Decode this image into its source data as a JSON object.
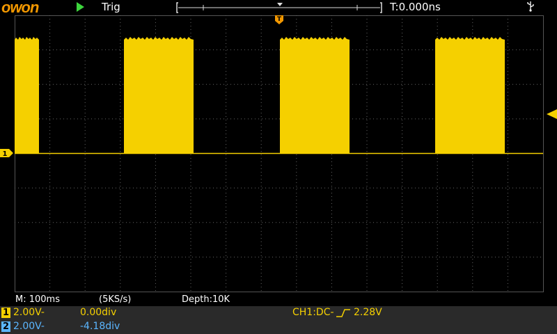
{
  "header": {
    "logo": "owon",
    "run_state": "run-triangle",
    "trigger_status": "Trig",
    "time_offset": "T:0.000ns",
    "usb_icon": "usb-icon"
  },
  "markers": {
    "trigger_position": "T",
    "ch1_ground": "1",
    "trigger_level": "trigger-level-arrow"
  },
  "status": {
    "timebase": "M: 100ms",
    "sample_rate": "(5KS/s)",
    "depth": "Depth:10K"
  },
  "channels": [
    {
      "tag": "1",
      "volts": "2.00V-",
      "position": "0.00div",
      "color": "#f5d000",
      "text_color": "#f5d000"
    },
    {
      "tag": "2",
      "volts": "2.00V-",
      "position": "-4.18div",
      "color": "#5bb6ff",
      "text_color": "#5bb6ff"
    }
  ],
  "trigger": {
    "source_label": "CH1:DC-",
    "level": "2.28V"
  },
  "colors": {
    "ch1": "#f5d000",
    "ch2": "#5bb6ff",
    "brand": "#f39800",
    "run": "#3dd63d",
    "grid": "#555555"
  }
}
